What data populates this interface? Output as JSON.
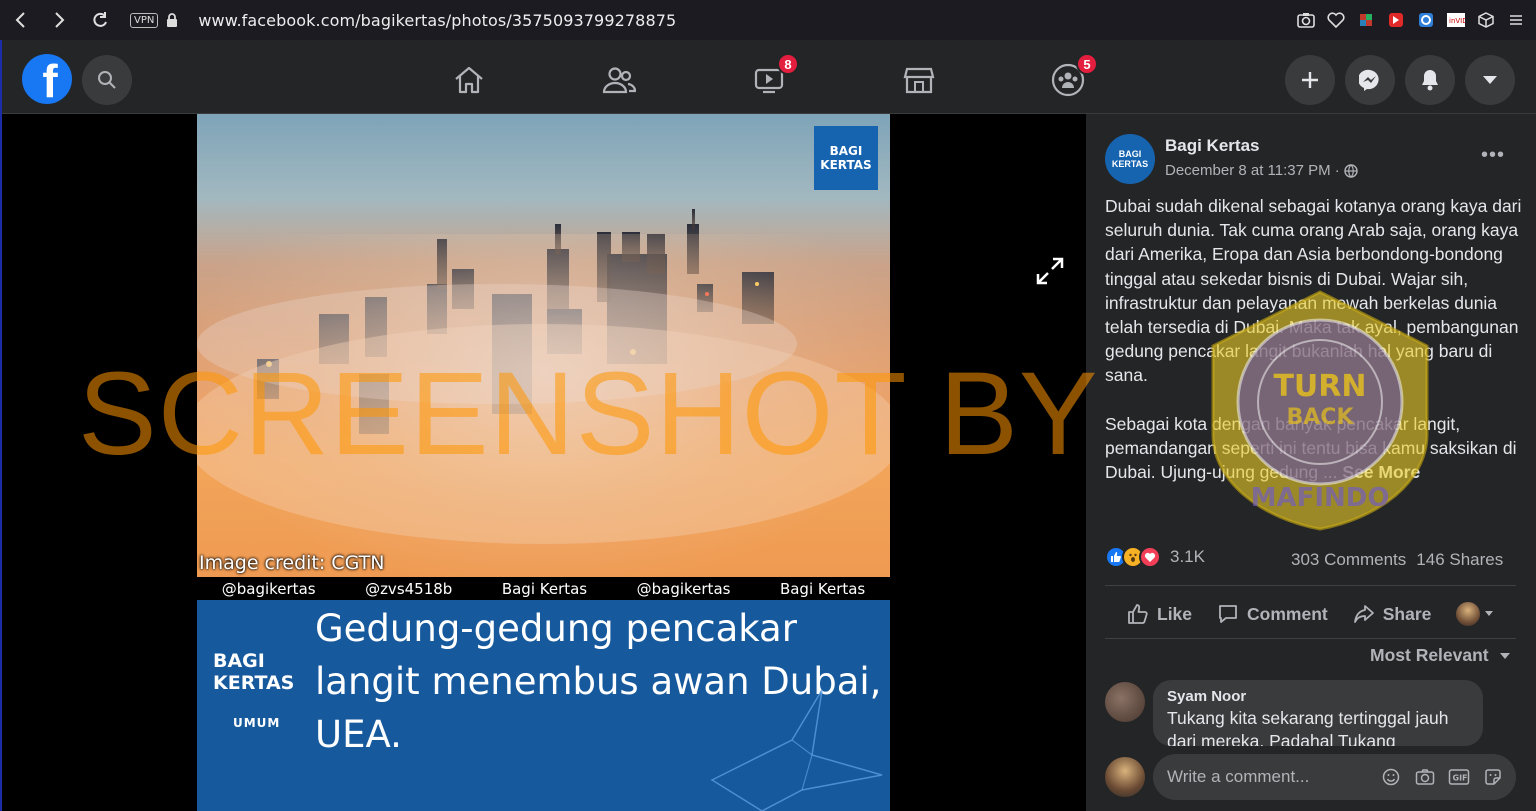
{
  "browser": {
    "vpn_label": "VPN",
    "url": "www.facebook.com/bagikertas/photos/3575093799278875"
  },
  "header": {
    "logo_letter": "f",
    "watch_badge": "8",
    "groups_badge": "5"
  },
  "photo": {
    "brand_line1": "BAGI",
    "brand_line2": "KERTAS",
    "image_credit": "Image credit: CGTN",
    "handles": [
      "@bagikertas",
      "@zvs4518b",
      "Bagi Kertas",
      "@bagikertas",
      "Bagi Kertas"
    ],
    "caption_text": "Gedung-gedung pencakar langit menembus awan Dubai, UEA.",
    "caption_logo_line1": "BAGI",
    "caption_logo_line2": "KERTAS",
    "caption_category": "UMUM"
  },
  "watermark": {
    "text": "SCREENSHOT BY",
    "seal_top": "TURN",
    "seal_mid": "BACK",
    "seal_bottom": "MAFINDO"
  },
  "post": {
    "page_name": "Bagi Kertas",
    "avatar_line1": "BAGI",
    "avatar_line2": "KERTAS",
    "date": "December 8 at 11:37 PM ·",
    "more_label": "•••",
    "paragraph1": "Dubai sudah dikenal sebagai kotanya orang kaya dari seluruh dunia. Tak cuma orang Arab saja, orang kaya dari Amerika, Eropa dan Asia berbondong-bondong tinggal atau sekedar bisnis di Dubai. Wajar sih, infrastruktur dan pelayanan mewah berkelas dunia telah tersedia di Dubai. Maka tak ayal, pembangunan gedung pencakar langit bukanlah hal yang baru di sana.",
    "paragraph2": "Sebagai kota dengan banyak pencakar langit, pemandangan seperti ini tentu bisa kamu saksikan di Dubai. Ujung-ujung gedung ...",
    "see_more": "See More"
  },
  "engagement": {
    "reaction_count": "3.1K",
    "comments": "303 Comments",
    "shares": "146 Shares",
    "like_label": "Like",
    "comment_label": "Comment",
    "share_label": "Share",
    "sort_label": "Most Relevant"
  },
  "comment": {
    "author": "Syam Noor",
    "text": "Tukang kita sekarang tertinggal jauh dari mereka. Padahal Tukang"
  },
  "composer": {
    "placeholder": "Write a comment..."
  },
  "colors": {
    "fb_blue": "#1877f2",
    "badge_red": "#e41e3f",
    "watermark_orange": "#ff9600",
    "caption_blue": "#17599d"
  }
}
